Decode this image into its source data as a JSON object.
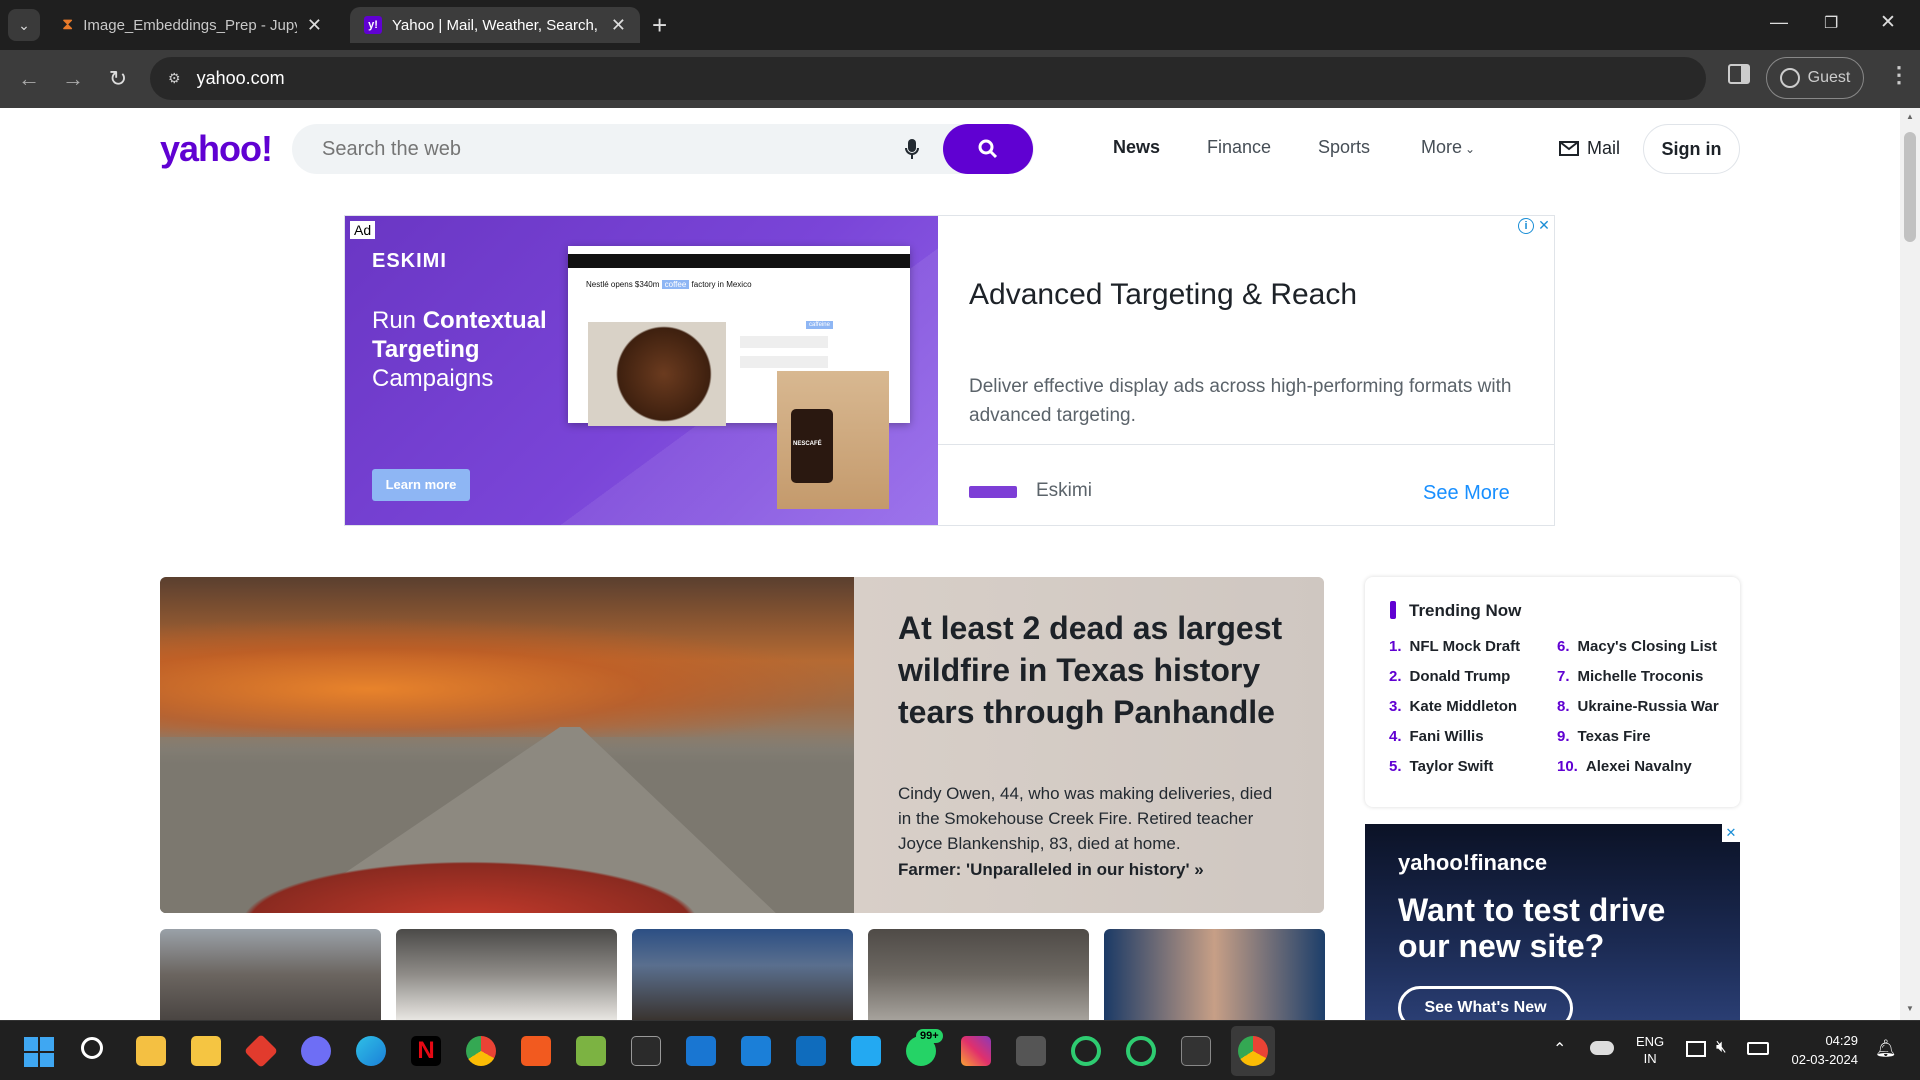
{
  "browser": {
    "tabs": [
      {
        "title": "Image_Embeddings_Prep - Jupyter"
      },
      {
        "title": "Yahoo | Mail, Weather, Search, Politics"
      }
    ],
    "new_tab": "+",
    "url": "yahoo.com",
    "profile": "Guest"
  },
  "header": {
    "logo": "yahoo!",
    "search_placeholder": "Search the web",
    "nav": [
      "News",
      "Finance",
      "Sports",
      "More"
    ],
    "mail": "Mail",
    "signin": "Sign in"
  },
  "ad": {
    "badge": "Ad",
    "brand": "ESKIMI",
    "tagline_1": "Run",
    "tagline_1b": "Contextual",
    "tagline_2": "Targeting",
    "tagline_3": "Campaigns",
    "cta": "Learn more",
    "mock_headline": "Nestlé opens $340m",
    "mock_tag": "coffee",
    "mock_headline_end": "factory in Mexico",
    "mock_side_tag": "caffeine",
    "mock_brand": "NESCAFÉ",
    "title": "Advanced Targeting & Reach",
    "description": "Deliver effective display ads across high-performing formats with advanced targeting.",
    "advertiser": "Eskimi",
    "see_more": "See More"
  },
  "hero": {
    "headline": "At least 2 dead as largest wildfire in Texas history tears through Panhandle",
    "summary": "Cindy Owen, 44, who was making deliveries, died in the Smokehouse Creek Fire. Retired teacher Joyce Blankenship, 83, died at home.",
    "link": "Farmer: 'Unparalleled in our history' »"
  },
  "trending": {
    "title": "Trending Now",
    "items": [
      {
        "n": "1.",
        "label": "NFL Mock Draft"
      },
      {
        "n": "2.",
        "label": "Donald Trump"
      },
      {
        "n": "3.",
        "label": "Kate Middleton"
      },
      {
        "n": "4.",
        "label": "Fani Willis"
      },
      {
        "n": "5.",
        "label": "Taylor Swift"
      },
      {
        "n": "6.",
        "label": "Macy's Closing List"
      },
      {
        "n": "7.",
        "label": "Michelle Troconis"
      },
      {
        "n": "8.",
        "label": "Ukraine-Russia War"
      },
      {
        "n": "9.",
        "label": "Texas Fire"
      },
      {
        "n": "10.",
        "label": "Alexei Navalny"
      }
    ]
  },
  "finance_ad": {
    "logo": "yahoo!finance",
    "headline": "Want to test drive our new site?",
    "cta": "See What's New"
  },
  "taskbar": {
    "lang": "ENG",
    "region": "IN",
    "time": "04:29",
    "date": "02-03-2024",
    "badge": "99+"
  },
  "colors": {
    "brand": "#6001d2",
    "link": "#188fff"
  }
}
